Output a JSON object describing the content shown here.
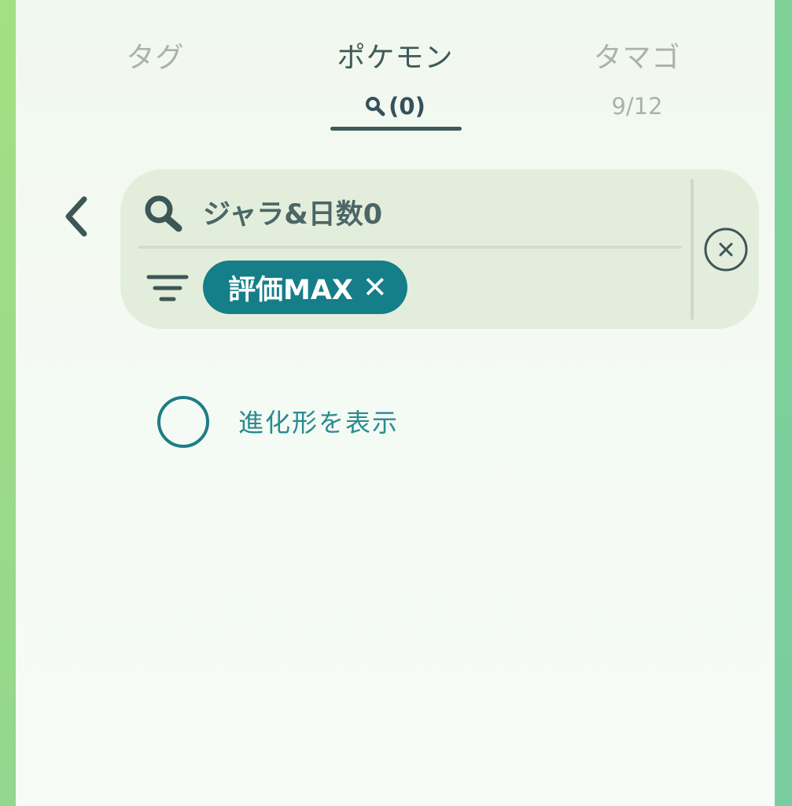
{
  "tabs": {
    "tags": {
      "label": "タグ"
    },
    "pokemon": {
      "label": "ポケモン",
      "count": "(0)",
      "active": true
    },
    "eggs": {
      "label": "タマゴ",
      "count": "9/12"
    }
  },
  "search": {
    "query": "ジャラ&日数0",
    "filter_chip": {
      "label": "評価MAX",
      "remove_symbol": "✕"
    }
  },
  "options": {
    "show_evolutions_label": "進化形を表示",
    "show_evolutions_checked": false
  },
  "icons": {
    "back": "chevron-left-icon",
    "search": "search-icon",
    "filter": "filter-icon",
    "clear": "clear-circle-icon"
  },
  "colors": {
    "accent": "#157e88",
    "tab_active": "#3f5a5a",
    "tab_inactive": "#a9b2ac",
    "search_bg": "#e3eddb"
  }
}
